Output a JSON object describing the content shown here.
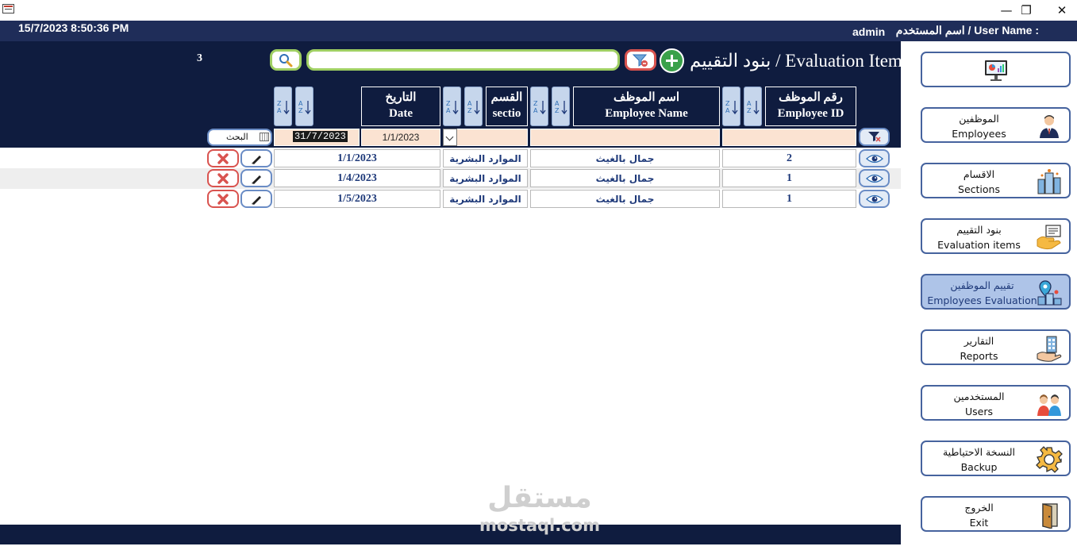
{
  "window": {
    "minimize_glyph": "—",
    "restore_glyph": "❐",
    "close_glyph": "✕"
  },
  "infobar": {
    "datetime": "15/7/2023 8:50:36 PM",
    "user_label": "اسم المستخدم / User Name :",
    "user_name": "admin"
  },
  "main": {
    "title": "بنود التقييم / Evaluation Items",
    "record_count": "3",
    "search": {
      "value": "",
      "placeholder": ""
    }
  },
  "columns": [
    {
      "id": "employee_id",
      "ar": "رقم الموظف",
      "en": "Employee ID"
    },
    {
      "id": "employee_name",
      "ar": "اسم الموظف",
      "en": "Employee Name"
    },
    {
      "id": "section",
      "ar": "القسم",
      "en": "sectio"
    },
    {
      "id": "date",
      "ar": "التاريخ",
      "en": "Date"
    }
  ],
  "filters": {
    "date_from": "1/1/2023",
    "date_to": "31/7/2023",
    "search_label": "البحث"
  },
  "rows": [
    {
      "employee_id": "2",
      "employee_name": "جمال بالغيث",
      "section": "الموارد البشرية",
      "date": "1/1/2023"
    },
    {
      "employee_id": "1",
      "employee_name": "جمال بالغيث",
      "section": "الموارد البشرية",
      "date": "1/4/2023"
    },
    {
      "employee_id": "1",
      "employee_name": "جمال بالغيث",
      "section": "الموارد البشرية",
      "date": "1/5/2023"
    }
  ],
  "nav": [
    {
      "ar": "",
      "en": "",
      "icon": "dashboard-monitor-icon"
    },
    {
      "ar": "الموظفين",
      "en": "Employees",
      "icon": "employee-icon"
    },
    {
      "ar": "الاقسام",
      "en": "Sections",
      "icon": "buildings-icon"
    },
    {
      "ar": "بنود التقييم",
      "en": "Evaluation items",
      "icon": "evaluation-hand-icon"
    },
    {
      "ar": "تقييم الموظفين",
      "en": "Employees Evaluation",
      "icon": "location-buildings-icon",
      "active": true
    },
    {
      "ar": "التقارير",
      "en": "Reports",
      "icon": "reports-hand-icon"
    },
    {
      "ar": "المستخدمين",
      "en": "Users",
      "icon": "users-icon"
    },
    {
      "ar": "النسخة الاحتياطية",
      "en": "Backup",
      "icon": "gear-icon"
    },
    {
      "ar": "الخروج",
      "en": "Exit",
      "icon": "door-exit-icon"
    }
  ],
  "watermark": {
    "ar": "مستقل",
    "en": "mostaql.com"
  },
  "colors": {
    "navy": "#0f1c3f",
    "infobar": "#1f2d59",
    "filter_fill": "#fbe3d2",
    "green_accent": "#9fcf63",
    "red_accent": "#d9534f",
    "nav_border": "#46639e",
    "nav_active": "#aec4e8",
    "cell_text": "#1f3a7a"
  }
}
